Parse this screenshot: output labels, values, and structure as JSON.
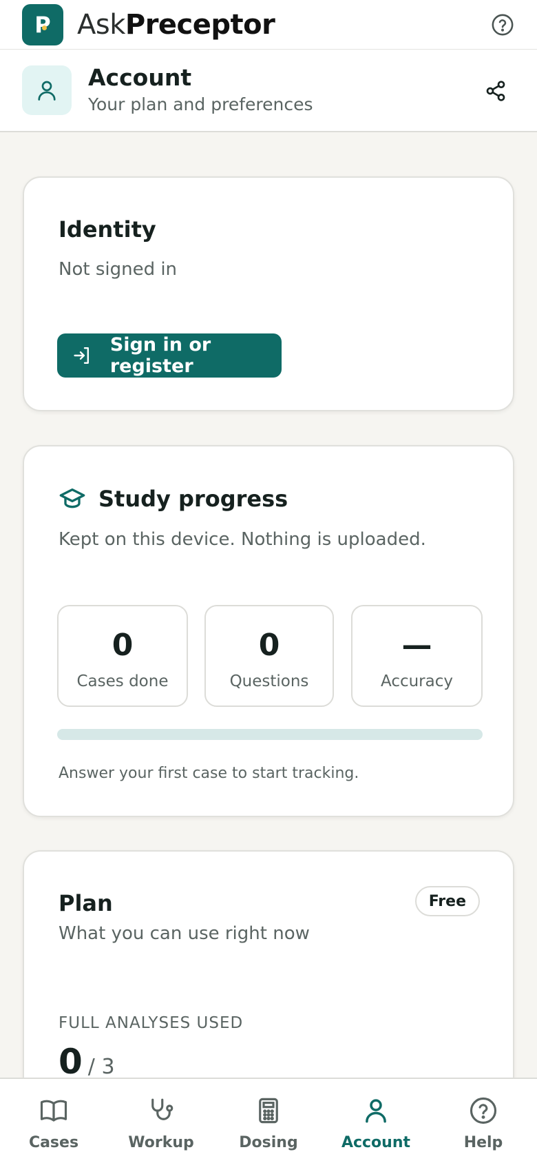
{
  "brand": {
    "logo_letter": "P",
    "name_light": "Ask",
    "name_bold": "Preceptor"
  },
  "header": {
    "title": "Account",
    "subtitle": "Your plan and preferences"
  },
  "identity": {
    "title": "Identity",
    "status": "Not signed in",
    "signin_label": "Sign in or register"
  },
  "study_progress": {
    "title": "Study progress",
    "subtitle": "Kept on this device. Nothing is uploaded.",
    "stats": [
      {
        "value": "0",
        "label": "Cases done"
      },
      {
        "value": "0",
        "label": "Questions"
      },
      {
        "value": "—",
        "label": "Accuracy"
      }
    ],
    "progress_fraction": 0,
    "hint": "Answer your first case to start tracking."
  },
  "plan": {
    "title": "Plan",
    "subtitle": "What you can use right now",
    "badge": "Free",
    "usage_label": "FULL ANALYSES USED",
    "usage_used": "0",
    "usage_total": "/ 3"
  },
  "nav": {
    "items": [
      {
        "label": "Cases",
        "icon": "book-icon",
        "active": false
      },
      {
        "label": "Workup",
        "icon": "stethoscope-icon",
        "active": false
      },
      {
        "label": "Dosing",
        "icon": "calculator-icon",
        "active": false
      },
      {
        "label": "Account",
        "icon": "user-icon",
        "active": true
      },
      {
        "label": "Help",
        "icon": "help-circle-icon",
        "active": false
      }
    ]
  },
  "colors": {
    "accent": "#0f6b66",
    "accent_light": "#e2f4f3",
    "background": "#f6f5f1"
  }
}
